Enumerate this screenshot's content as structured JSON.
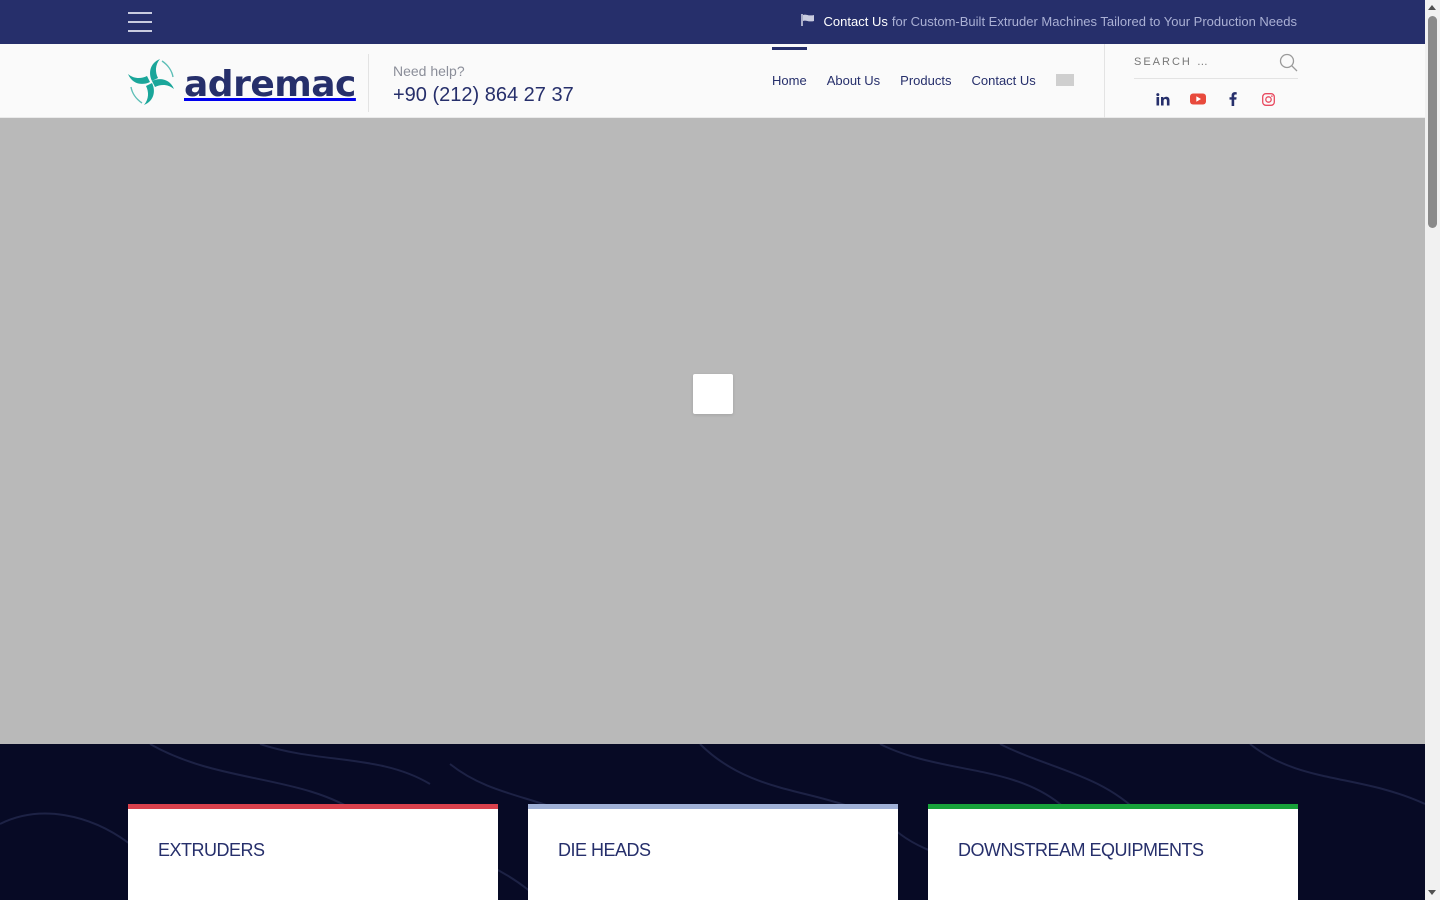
{
  "topbar": {
    "menu_icon": "hamburger-menu-icon",
    "promo_icon": "flag-icon",
    "promo_link": "Contact Us",
    "promo_text": "for Custom-Built Extruder Machines Tailored to Your Production Needs"
  },
  "header": {
    "logo_icon": "swirl-logo-icon",
    "logo_text": "adremac",
    "help_label": "Need help?",
    "help_phone": "+90 (212) 864 27 37",
    "nav": [
      "Home",
      "About Us",
      "Products",
      "Contact Us"
    ],
    "active_nav": "Home",
    "search_placeholder": "SEARCH …",
    "search_icon": "search-icon",
    "social": [
      "linkedin-icon",
      "youtube-icon",
      "facebook-icon",
      "instagram-icon"
    ]
  },
  "products": {
    "cards": [
      {
        "title": "EXTRUDERS",
        "accent": "#d9414d"
      },
      {
        "title": "DIE HEADS",
        "accent": "#9fb0d6"
      },
      {
        "title": "DOWNSTREAM EQUIPMENTS",
        "accent": "#17a23a"
      }
    ]
  },
  "colors": {
    "brand_navy": "#262f6b",
    "logo_teal": "#1aa69a",
    "hero_gray": "#b9b9b9",
    "products_bg": "#070a25",
    "youtube_red": "#e84a3c",
    "instagram_red": "#e84a5f"
  }
}
